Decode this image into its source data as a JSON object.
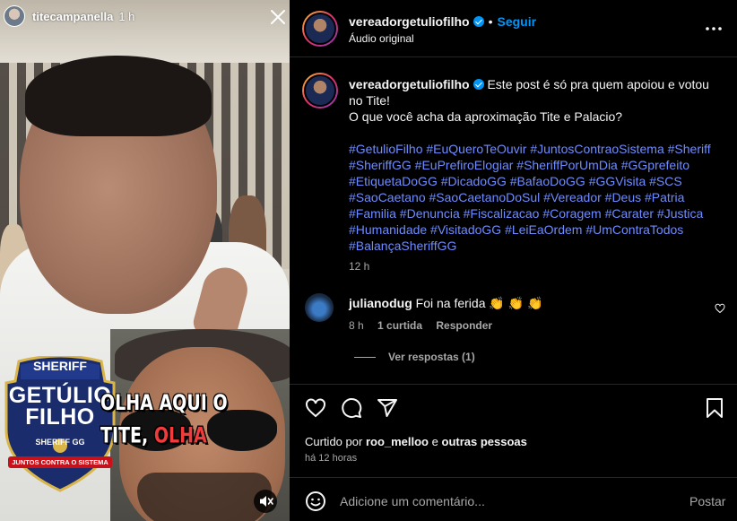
{
  "story": {
    "username": "titecampanella",
    "time": "1 h",
    "overlay_caption_line1": "OLHA AQUI O",
    "overlay_caption_line2": "TITE,",
    "overlay_caption_red": "OLHA",
    "badge": {
      "top": "SHERIFF",
      "name_line1": "GETÚLIO",
      "name_line2": "FILHO",
      "sub": "SHERIFF GG",
      "motto": "JUNTOS CONTRA O SISTEMA"
    }
  },
  "header": {
    "username": "vereadorgetuliofilho",
    "follow_label": "Seguir",
    "audio": "Áudio original",
    "more_icon": "more-horizontal-icon"
  },
  "post": {
    "username": "vereadorgetuliofilho",
    "text_line1": "Este post é só pra quem apoiou e votou no Tite!",
    "text_line2": "O que você acha da aproximação Tite e Palacio?",
    "hashtags": "#GetulioFilho #EuQueroTeOuvir #JuntosContraoSistema #Sheriff #SheriffGG #EuPrefiroElogiar #SheriffPorUmDia #GGprefeito #EtiquetaDoGG #DicadoGG #BafaoDoGG #GGVisita #SCS #SaoCaetano #SaoCaetanoDoSul #Vereador #Deus #Patria #Familia #Denuncia #Fiscalizacao #Coragem #Carater #Justica #Humanidade #VisitadoGG #LeiEaOrdem #UmContraTodos #BalançaSheriffGG",
    "time": "12 h"
  },
  "comment": {
    "username": "julianodug",
    "text": "Foi na ferida 👏 👏 👏",
    "time": "8 h",
    "likes": "1 curtida",
    "reply": "Responder",
    "view_replies": "Ver respostas (1)"
  },
  "likes": {
    "prefix": "Curtido por",
    "user": "roo_melloo",
    "conj": "e",
    "others": "outras pessoas"
  },
  "posted_ago": "há 12 horas",
  "comment_input": {
    "placeholder": "Adicione um comentário...",
    "post_label": "Postar"
  },
  "colors": {
    "accent": "#0095f6",
    "hashtag": "#6f8cff",
    "muted": "#a8a8a8",
    "background": "#000000"
  }
}
